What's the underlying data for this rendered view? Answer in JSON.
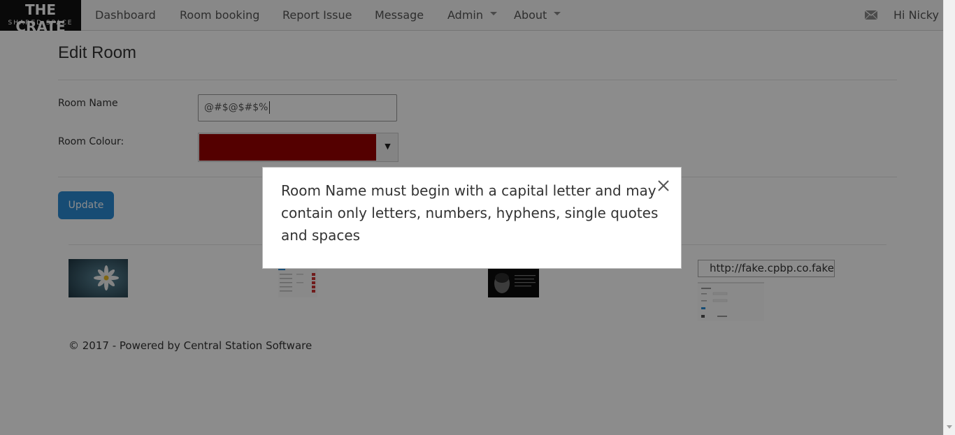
{
  "brand": {
    "line1": "THE CRATE",
    "line2": "SHARED SPACE"
  },
  "nav": {
    "items": [
      {
        "label": "Dashboard"
      },
      {
        "label": "Room booking"
      },
      {
        "label": "Report Issue"
      },
      {
        "label": "Message"
      },
      {
        "label": "Admin"
      },
      {
        "label": "About"
      }
    ],
    "greeting": "Hi Nicky"
  },
  "page": {
    "title": "Edit Room"
  },
  "form": {
    "room_name_label": "Room Name",
    "room_name_value": "@#$@$#$%",
    "room_colour_label": "Room Colour:",
    "room_colour_value": "#990000",
    "update_label": "Update"
  },
  "images": {
    "broken_alt": "http://fake.cpbp.co.fake"
  },
  "footer": {
    "text": "© 2017 - Powered by Central Station Software"
  },
  "modal": {
    "message": "Room Name must begin with a capital letter and may contain only letters, numbers, hyphens, single quotes and spaces"
  },
  "colors": {
    "accent": "#2a8ad3",
    "brand_bg": "#111111",
    "overlay": "rgba(0,0,0,0.45)"
  }
}
